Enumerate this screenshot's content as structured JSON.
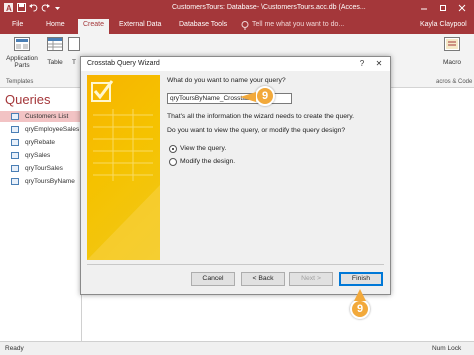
{
  "window": {
    "title": "CustomersTours: Database- \\CustomersTours.acc.db (Acces...",
    "minimize_icon": "minimize-icon",
    "restore_icon": "restore-icon",
    "close_icon": "close-icon"
  },
  "ribbon_tabs": [
    {
      "label": "File"
    },
    {
      "label": "Home"
    },
    {
      "label": "Create"
    },
    {
      "label": "External Data"
    },
    {
      "label": "Database Tools"
    }
  ],
  "active_tab": "Create",
  "tellme": "Tell me what you want to do...",
  "user": "Kayla Claypool",
  "ribbon": {
    "application_parts": "Application Parts",
    "table": "Table",
    "templates_group": "Templates",
    "macro": "Macro",
    "macros_group": "acros & Code",
    "t_partial": "T"
  },
  "nav": {
    "header": "Queries",
    "items": [
      {
        "label": "Customers List",
        "selected": true
      },
      {
        "label": "qryEmployeeSales",
        "selected": false
      },
      {
        "label": "qryRebate",
        "selected": false
      },
      {
        "label": "qrySales",
        "selected": false
      },
      {
        "label": "qryTourSales",
        "selected": false
      },
      {
        "label": "qryToursByName",
        "selected": false
      }
    ]
  },
  "dialog": {
    "title": "Crosstab Query Wizard",
    "help": "?",
    "close": "✕",
    "question": "What do you want to name your query?",
    "query_name": "qryToursByName_Crosstab",
    "info": "That's all the information the wizard needs to create the query.",
    "view_question": "Do you want to view the query, or modify the query design?",
    "options": [
      {
        "label": "View the query.",
        "selected": true
      },
      {
        "label": "Modify the design.",
        "selected": false
      }
    ],
    "buttons": {
      "cancel": "Cancel",
      "back": "< Back",
      "next": "Next >",
      "finish": "Finish"
    }
  },
  "callouts": {
    "name_step": "9",
    "finish_step": "9",
    "color": "#f2a93b"
  },
  "status": {
    "left": "Ready",
    "right": "Num Lock"
  },
  "colors": {
    "accent": "#a4373a",
    "selection": "#f2c3c4",
    "wizard_art": "#f7b400"
  }
}
